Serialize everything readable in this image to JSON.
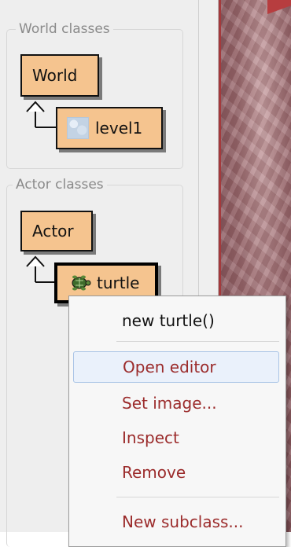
{
  "world_classes": {
    "title": "World classes",
    "world_node": "World",
    "level_node": "level1"
  },
  "actor_classes": {
    "title": "Actor classes",
    "actor_node": "Actor",
    "turtle_node": "turtle"
  },
  "context_menu": {
    "items": [
      {
        "label": "new turtle()"
      },
      {
        "label": "Open editor"
      },
      {
        "label": "Set image..."
      },
      {
        "label": "Inspect"
      },
      {
        "label": "Remove"
      },
      {
        "label": "New subclass..."
      }
    ]
  },
  "colors": {
    "class_fill": "#f5c48f",
    "menu_text_accent": "#9b2b2b",
    "menu_highlight": "#eaf1fb"
  }
}
